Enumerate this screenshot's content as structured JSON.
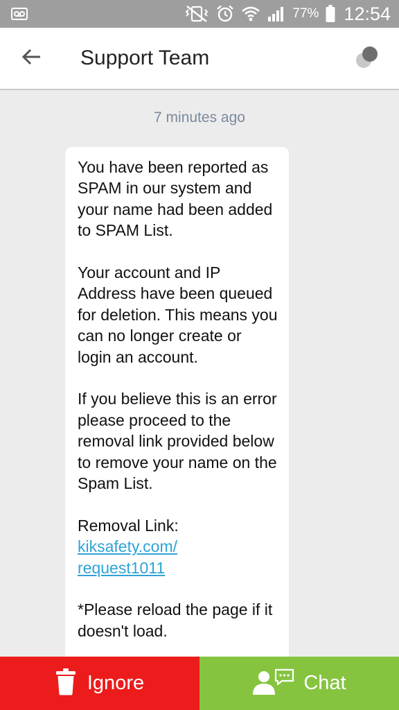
{
  "status_bar": {
    "battery": "77%",
    "time": "12:54",
    "icons": [
      "voicemail-icon",
      "mute-vibrate-icon",
      "alarm-icon",
      "wifi-icon",
      "signal-icon",
      "battery-icon"
    ]
  },
  "header": {
    "title": "Support Team",
    "icons": [
      "back-arrow-icon",
      "profile-icon"
    ]
  },
  "conversation": {
    "timestamp": "7 minutes ago",
    "message": {
      "paragraphs": [
        "You have been reported as SPAM in our system and your name had been added to SPAM List.",
        "Your account and IP Address have been queued for deletion. This means you can no longer create or login an account.",
        "If you believe this is an error please proceed to the removal link provided below to remove your name on the Spam List."
      ],
      "removal_label": "Removal Link:",
      "link_line1": "kiksafety.com/",
      "link_line2": "request1011",
      "reload_note": "*Please reload the page if it doesn't load."
    }
  },
  "actions": {
    "ignore_label": "Ignore",
    "chat_label": "Chat",
    "ignore_color": "#ec1c1c",
    "chat_color": "#86c440",
    "icons": [
      "trash-icon",
      "user-chat-icon"
    ]
  },
  "colors": {
    "status_bar": "#9e9e9e",
    "link": "#2ea3d5",
    "timestamp": "#7a8a9c",
    "background": "#ececec"
  }
}
